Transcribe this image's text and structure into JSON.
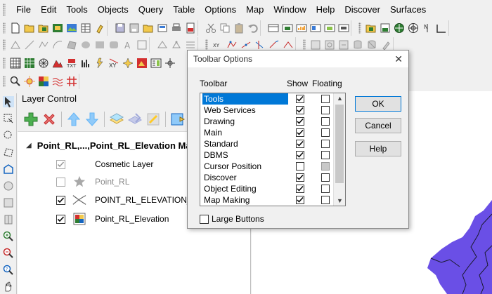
{
  "menu": [
    "File",
    "Edit",
    "Tools",
    "Objects",
    "Query",
    "Table",
    "Options",
    "Map",
    "Window",
    "Help",
    "Discover",
    "Surfaces"
  ],
  "layer_control": {
    "title": "Layer Control",
    "map_name": "Point_RL,...,Point_RL_Elevation Map",
    "layers": [
      {
        "name": "Cosmetic Layer",
        "checked": true,
        "disabled": true,
        "icon": "cosmetic-layer-icon"
      },
      {
        "name": "Point_RL",
        "checked": false,
        "disabled": true,
        "icon": "star-point-icon"
      },
      {
        "name": "POINT_RL_ELEVATION_co",
        "checked": true,
        "disabled": false,
        "icon": "contour-lines-icon"
      },
      {
        "name": "Point_RL_Elevation",
        "checked": true,
        "disabled": false,
        "icon": "raster-grid-icon"
      }
    ]
  },
  "dialog": {
    "title": "Toolbar Options",
    "close_label": "✕",
    "col_toolbar": "Toolbar",
    "col_show": "Show",
    "col_floating": "Floating",
    "rows": [
      {
        "name": "Tools",
        "show": true,
        "floating": false,
        "selected": true
      },
      {
        "name": "Web Services",
        "show": true,
        "floating": false
      },
      {
        "name": "Drawing",
        "show": true,
        "floating": false
      },
      {
        "name": "Main",
        "show": true,
        "floating": false
      },
      {
        "name": "Standard",
        "show": true,
        "floating": false
      },
      {
        "name": "DBMS",
        "show": true,
        "floating": false
      },
      {
        "name": "Cursor Position",
        "show": false,
        "floating": false,
        "floating_disabled": true
      },
      {
        "name": "Discover",
        "show": true,
        "floating": false
      },
      {
        "name": "Object Editing",
        "show": true,
        "floating": false
      },
      {
        "name": "Map Making",
        "show": true,
        "floating": false
      }
    ],
    "ok_label": "OK",
    "cancel_label": "Cancel",
    "help_label": "Help",
    "large_buttons_label": "Large Buttons",
    "large_buttons_checked": false
  },
  "colors": {
    "selection": "#0078d7",
    "map_fill": "#6a4fe6"
  }
}
